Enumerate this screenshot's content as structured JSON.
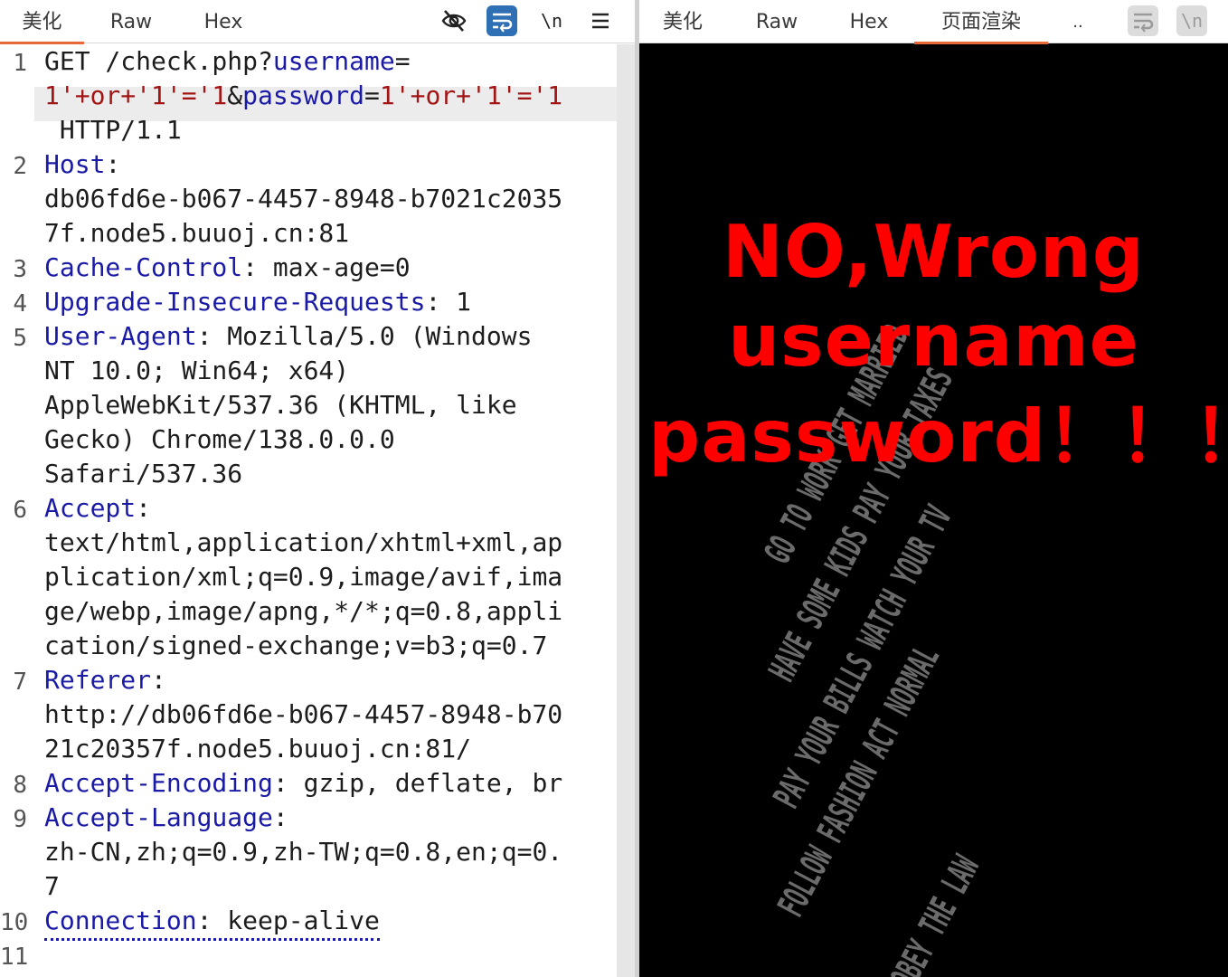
{
  "left_panel": {
    "tabs": [
      "美化",
      "Raw",
      "Hex"
    ],
    "active_tab": "美化",
    "toolbar_icons": [
      "hide-icon",
      "wrap-lines-icon",
      "newline-icon",
      "menu-icon"
    ],
    "newline_label": "\\n",
    "line_numbers": [
      "1",
      "2",
      "3",
      "4",
      "5",
      "6",
      "7",
      "8",
      "9",
      "10",
      "11"
    ],
    "request_lines": {
      "l1_method_path": "GET /check.php?",
      "l1_username_key": "username",
      "l1_eq1": "=",
      "l1_username_val": "1'+or+'1'='1",
      "l1_amp": "&",
      "l1_password_key": "password",
      "l1_eq2": "=",
      "l1_password_val": "1'+or+'1'='1",
      "l1_protocol": " HTTP/1.1",
      "host_key": "Host",
      "host_val_1": "db06fd6e-b067-4457-8948-b7021c2035",
      "host_val_2": "7f.node5.buuoj.cn:81",
      "cache_key": "Cache-Control",
      "cache_val": "max-age=0",
      "upgrade_key": "Upgrade-Insecure-Requests",
      "upgrade_val": "1",
      "ua_key": "User-Agent",
      "ua_val_1": "Mozilla/5.0 (Windows",
      "ua_val_2": "NT 10.0; Win64; x64)",
      "ua_val_3": "AppleWebKit/537.36 (KHTML, like",
      "ua_val_4": "Gecko) Chrome/138.0.0.0",
      "ua_val_5": "Safari/537.36",
      "accept_key": "Accept",
      "accept_val_1": "text/html,application/xhtml+xml,ap",
      "accept_val_2": "plication/xml;q=0.9,image/avif,ima",
      "accept_val_3": "ge/webp,image/apng,*/*;q=0.8,appli",
      "accept_val_4": "cation/signed-exchange;v=b3;q=0.7",
      "referer_key": "Referer",
      "referer_val_1": "http://db06fd6e-b067-4457-8948-b70",
      "referer_val_2": "21c20357f.node5.buuoj.cn:81/",
      "encoding_key": "Accept-Encoding",
      "encoding_val": "gzip, deflate, br",
      "language_key": "Accept-Language",
      "language_val_1": "zh-CN,zh;q=0.9,zh-TW;q=0.8,en;q=0.",
      "language_val_2": "7",
      "connection_key": "Connection",
      "connection_val": "keep-alive",
      "colon": ":"
    }
  },
  "right_panel": {
    "tabs": [
      "美化",
      "Raw",
      "Hex",
      "页面渲染",
      ".."
    ],
    "active_tab": "页面渲染",
    "toolbar_icons": [
      "wrap-lines-icon",
      "newline-icon"
    ],
    "newline_label": "\\n",
    "render": {
      "message_lines": [
        "NO,Wrong",
        "username",
        "password！！！"
      ],
      "message_color": "#ff0000",
      "background_text_lines": [
        "GO TO WORK GET MARRIED",
        "HAVE SOME KIDS PAY YOUR TAXES",
        "PAY YOUR BILLS WATCH YOUR TV",
        "FOLLOW FASHION ACT NORMAL",
        "OBEY THE LAW"
      ]
    }
  },
  "colors": {
    "header_key": "#1a1aa6",
    "param_value": "#a31515",
    "active_tab_underline": "#e8683a",
    "wrap_icon_bg": "#2f6fb3"
  }
}
